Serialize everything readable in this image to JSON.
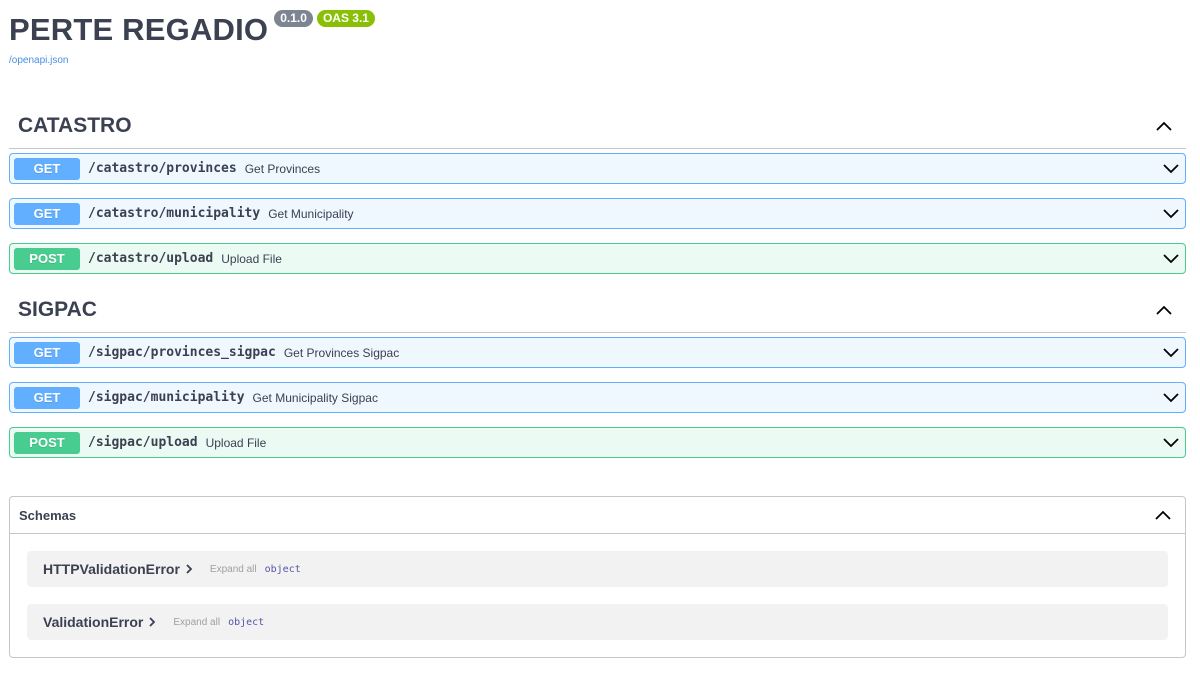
{
  "info": {
    "title": "PERTE REGADIO",
    "version": "0.1.0",
    "oas": "OAS 3.1",
    "spec_link": "/openapi.json"
  },
  "tags": [
    {
      "name": "CATASTRO",
      "operations": [
        {
          "method": "GET",
          "path": "/catastro/provinces",
          "summary": "Get Provinces"
        },
        {
          "method": "GET",
          "path": "/catastro/municipality",
          "summary": "Get Municipality"
        },
        {
          "method": "POST",
          "path": "/catastro/upload",
          "summary": "Upload File"
        }
      ]
    },
    {
      "name": "SIGPAC",
      "operations": [
        {
          "method": "GET",
          "path": "/sigpac/provinces_sigpac",
          "summary": "Get Provinces Sigpac"
        },
        {
          "method": "GET",
          "path": "/sigpac/municipality",
          "summary": "Get Municipality Sigpac"
        },
        {
          "method": "POST",
          "path": "/sigpac/upload",
          "summary": "Upload File"
        }
      ]
    }
  ],
  "schemas": {
    "title": "Schemas",
    "models": [
      {
        "name": "HTTPValidationError",
        "expand_label": "Expand all",
        "type": "object"
      },
      {
        "name": "ValidationError",
        "expand_label": "Expand all",
        "type": "object"
      }
    ]
  },
  "colors": {
    "get": "#61affe",
    "post": "#49cc90",
    "version_badge": "#7d8492",
    "oas_badge": "#89bf04"
  },
  "icons": {
    "collapse": "chevron-up-icon",
    "expand": "chevron-down-icon",
    "model_arrow": "chevron-right-icon"
  }
}
